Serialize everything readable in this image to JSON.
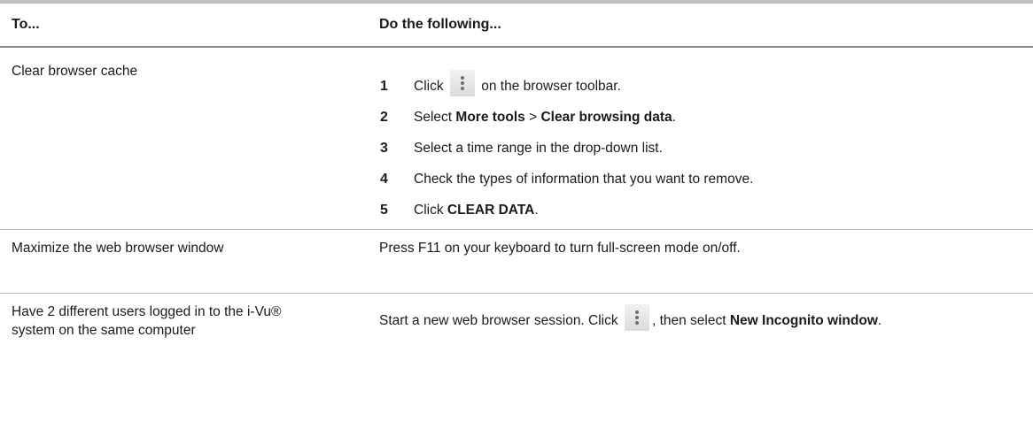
{
  "table": {
    "header": {
      "col_to": "To...",
      "col_do": "Do the following..."
    },
    "rows": [
      {
        "task": "Clear browser cache",
        "steps": [
          {
            "num": "1",
            "before": "Click",
            "icon": "chrome-menu-kebab-icon",
            "after": "on the browser toolbar."
          },
          {
            "num": "2",
            "pre": "Select",
            "bold1": "More tools",
            "sep": ">",
            "bold2": "Clear browsing data",
            "post": "."
          },
          {
            "num": "3",
            "text": "Select a time range in the drop-down list."
          },
          {
            "num": "4",
            "text": "Check the types of information that you want to remove."
          },
          {
            "num": "5",
            "pre": "Click",
            "bold": "CLEAR DATA",
            "post": "."
          }
        ]
      },
      {
        "task": "Maximize the web browser window",
        "action": "Press F11 on your keyboard to turn full-screen mode on/off."
      },
      {
        "task": "Have 2 different users logged in to the i-Vu® system on the same computer",
        "action_pre": "Start a new web browser session. Click",
        "icon": "chrome-menu-kebab-icon",
        "action_mid": ", then select",
        "action_bold": "New Incognito window",
        "action_post": "."
      }
    ]
  }
}
